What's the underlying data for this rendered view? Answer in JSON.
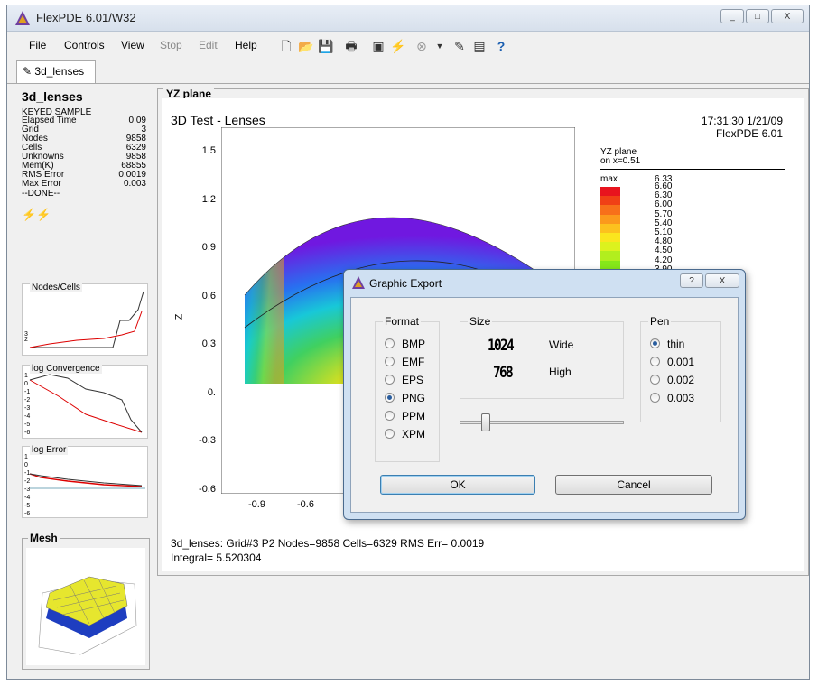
{
  "window": {
    "title": "FlexPDE  6.01/W32",
    "controls": [
      "_",
      "□",
      "X"
    ]
  },
  "menu": [
    "File",
    "Controls",
    "View",
    "Stop",
    "Edit",
    "Help"
  ],
  "menu_disabled": [
    false,
    false,
    false,
    true,
    true,
    false
  ],
  "toolbar_icons": [
    "new-icon",
    "open-icon",
    "save-icon",
    "print-icon",
    "box-icon",
    "run-icon",
    "stop-icon",
    "dropdown-icon",
    "edit-icon",
    "window-icon",
    "help-icon"
  ],
  "tab": {
    "label": "3d_lenses"
  },
  "left": {
    "title": "3d_lenses",
    "subtitle": "KEYED SAMPLE",
    "stats": [
      {
        "label": "Elapsed Time",
        "value": "0:09"
      },
      {
        "label": "Grid",
        "value": "3"
      },
      {
        "label": "Nodes",
        "value": "9858"
      },
      {
        "label": "Cells",
        "value": "6329"
      },
      {
        "label": "Unknowns",
        "value": "9858"
      },
      {
        "label": "Mem(K)",
        "value": "68855"
      },
      {
        "label": "RMS Error",
        "value": "0.0019"
      },
      {
        "label": "Max Error",
        "value": "0.003"
      }
    ],
    "done": "--DONE--",
    "mini_charts": [
      {
        "label": "Nodes/Cells",
        "ticks": [
          "3",
          "2"
        ]
      },
      {
        "label": "log Convergence",
        "ticks": [
          "1",
          "0",
          "-1",
          "-2",
          "-3",
          "-4",
          "-5",
          "-6"
        ]
      },
      {
        "label": "log Error",
        "ticks": [
          "1",
          "0",
          "-1",
          "-2",
          "-3",
          "-4",
          "-5",
          "-6"
        ]
      }
    ],
    "mesh_label": "Mesh"
  },
  "plot": {
    "panel_title": "YZ plane",
    "title": "3D Test - Lenses",
    "timestamp": "17:31:30 1/21/09",
    "version": "FlexPDE 6.01",
    "legend_title": "YZ plane",
    "legend_sub": "on x=0.51",
    "legend_head": "max",
    "legend_max": "6.33",
    "legend_values": [
      "6.60",
      "6.30",
      "6.00",
      "5.70",
      "5.40",
      "5.10",
      "4.80",
      "4.50",
      "4.20",
      "3.90"
    ],
    "legend_colors": [
      "#e8141e",
      "#f04016",
      "#f7701a",
      "#fb9a1c",
      "#fcc21e",
      "#fae61e",
      "#dcf21e",
      "#b2ee1e",
      "#86e81a",
      "#5ee21c"
    ],
    "z_ticks": [
      "1.5",
      "1.2",
      "0.9",
      "0.6",
      "0.3",
      "0.",
      "-0.3",
      "-0.6"
    ],
    "x_ticks": [
      "-0.9",
      "-0.6"
    ],
    "ylabel": "Z",
    "footer1": "3d_lenses:  Grid#3  P2  Nodes=9858 Cells=6329 RMS Err= 0.0019",
    "footer2": "Integral=  5.520304"
  },
  "dialog": {
    "title": "Graphic Export",
    "help": "?",
    "close": "X",
    "format_label": "Format",
    "formats": [
      "BMP",
      "EMF",
      "EPS",
      "PNG",
      "PPM",
      "XPM"
    ],
    "format_selected": "PNG",
    "size_label": "Size",
    "width": "1024",
    "width_label": "Wide",
    "height": "768",
    "height_label": "High",
    "slider_level": 0.14,
    "pen_label": "Pen",
    "pens": [
      "thin",
      "0.001",
      "0.002",
      "0.003"
    ],
    "pen_selected": "thin",
    "ok": "OK",
    "cancel": "Cancel"
  }
}
